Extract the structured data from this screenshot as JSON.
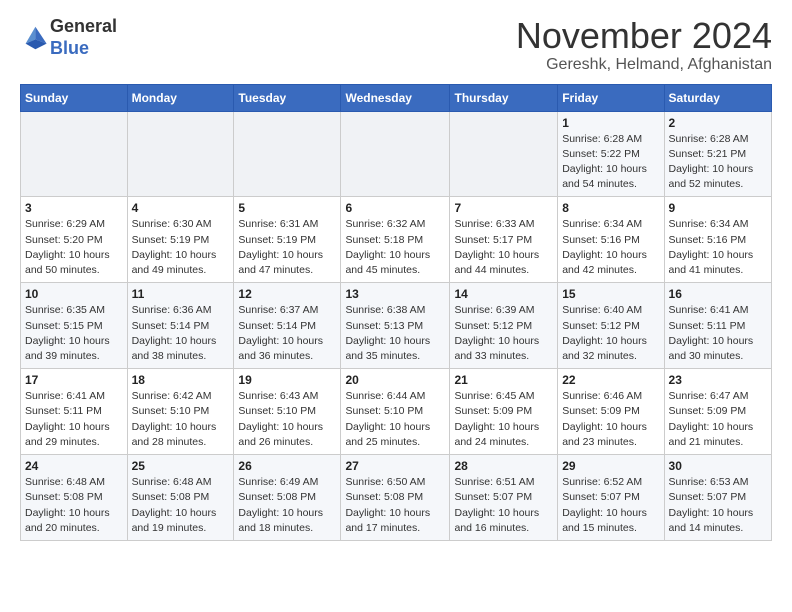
{
  "header": {
    "logo_general": "General",
    "logo_blue": "Blue",
    "month_title": "November 2024",
    "location": "Gereshk, Helmand, Afghanistan"
  },
  "calendar": {
    "days_of_week": [
      "Sunday",
      "Monday",
      "Tuesday",
      "Wednesday",
      "Thursday",
      "Friday",
      "Saturday"
    ],
    "weeks": [
      [
        {
          "day": "",
          "info": ""
        },
        {
          "day": "",
          "info": ""
        },
        {
          "day": "",
          "info": ""
        },
        {
          "day": "",
          "info": ""
        },
        {
          "day": "",
          "info": ""
        },
        {
          "day": "1",
          "info": "Sunrise: 6:28 AM\nSunset: 5:22 PM\nDaylight: 10 hours\nand 54 minutes."
        },
        {
          "day": "2",
          "info": "Sunrise: 6:28 AM\nSunset: 5:21 PM\nDaylight: 10 hours\nand 52 minutes."
        }
      ],
      [
        {
          "day": "3",
          "info": "Sunrise: 6:29 AM\nSunset: 5:20 PM\nDaylight: 10 hours\nand 50 minutes."
        },
        {
          "day": "4",
          "info": "Sunrise: 6:30 AM\nSunset: 5:19 PM\nDaylight: 10 hours\nand 49 minutes."
        },
        {
          "day": "5",
          "info": "Sunrise: 6:31 AM\nSunset: 5:19 PM\nDaylight: 10 hours\nand 47 minutes."
        },
        {
          "day": "6",
          "info": "Sunrise: 6:32 AM\nSunset: 5:18 PM\nDaylight: 10 hours\nand 45 minutes."
        },
        {
          "day": "7",
          "info": "Sunrise: 6:33 AM\nSunset: 5:17 PM\nDaylight: 10 hours\nand 44 minutes."
        },
        {
          "day": "8",
          "info": "Sunrise: 6:34 AM\nSunset: 5:16 PM\nDaylight: 10 hours\nand 42 minutes."
        },
        {
          "day": "9",
          "info": "Sunrise: 6:34 AM\nSunset: 5:16 PM\nDaylight: 10 hours\nand 41 minutes."
        }
      ],
      [
        {
          "day": "10",
          "info": "Sunrise: 6:35 AM\nSunset: 5:15 PM\nDaylight: 10 hours\nand 39 minutes."
        },
        {
          "day": "11",
          "info": "Sunrise: 6:36 AM\nSunset: 5:14 PM\nDaylight: 10 hours\nand 38 minutes."
        },
        {
          "day": "12",
          "info": "Sunrise: 6:37 AM\nSunset: 5:14 PM\nDaylight: 10 hours\nand 36 minutes."
        },
        {
          "day": "13",
          "info": "Sunrise: 6:38 AM\nSunset: 5:13 PM\nDaylight: 10 hours\nand 35 minutes."
        },
        {
          "day": "14",
          "info": "Sunrise: 6:39 AM\nSunset: 5:12 PM\nDaylight: 10 hours\nand 33 minutes."
        },
        {
          "day": "15",
          "info": "Sunrise: 6:40 AM\nSunset: 5:12 PM\nDaylight: 10 hours\nand 32 minutes."
        },
        {
          "day": "16",
          "info": "Sunrise: 6:41 AM\nSunset: 5:11 PM\nDaylight: 10 hours\nand 30 minutes."
        }
      ],
      [
        {
          "day": "17",
          "info": "Sunrise: 6:41 AM\nSunset: 5:11 PM\nDaylight: 10 hours\nand 29 minutes."
        },
        {
          "day": "18",
          "info": "Sunrise: 6:42 AM\nSunset: 5:10 PM\nDaylight: 10 hours\nand 28 minutes."
        },
        {
          "day": "19",
          "info": "Sunrise: 6:43 AM\nSunset: 5:10 PM\nDaylight: 10 hours\nand 26 minutes."
        },
        {
          "day": "20",
          "info": "Sunrise: 6:44 AM\nSunset: 5:10 PM\nDaylight: 10 hours\nand 25 minutes."
        },
        {
          "day": "21",
          "info": "Sunrise: 6:45 AM\nSunset: 5:09 PM\nDaylight: 10 hours\nand 24 minutes."
        },
        {
          "day": "22",
          "info": "Sunrise: 6:46 AM\nSunset: 5:09 PM\nDaylight: 10 hours\nand 23 minutes."
        },
        {
          "day": "23",
          "info": "Sunrise: 6:47 AM\nSunset: 5:09 PM\nDaylight: 10 hours\nand 21 minutes."
        }
      ],
      [
        {
          "day": "24",
          "info": "Sunrise: 6:48 AM\nSunset: 5:08 PM\nDaylight: 10 hours\nand 20 minutes."
        },
        {
          "day": "25",
          "info": "Sunrise: 6:48 AM\nSunset: 5:08 PM\nDaylight: 10 hours\nand 19 minutes."
        },
        {
          "day": "26",
          "info": "Sunrise: 6:49 AM\nSunset: 5:08 PM\nDaylight: 10 hours\nand 18 minutes."
        },
        {
          "day": "27",
          "info": "Sunrise: 6:50 AM\nSunset: 5:08 PM\nDaylight: 10 hours\nand 17 minutes."
        },
        {
          "day": "28",
          "info": "Sunrise: 6:51 AM\nSunset: 5:07 PM\nDaylight: 10 hours\nand 16 minutes."
        },
        {
          "day": "29",
          "info": "Sunrise: 6:52 AM\nSunset: 5:07 PM\nDaylight: 10 hours\nand 15 minutes."
        },
        {
          "day": "30",
          "info": "Sunrise: 6:53 AM\nSunset: 5:07 PM\nDaylight: 10 hours\nand 14 minutes."
        }
      ]
    ]
  }
}
